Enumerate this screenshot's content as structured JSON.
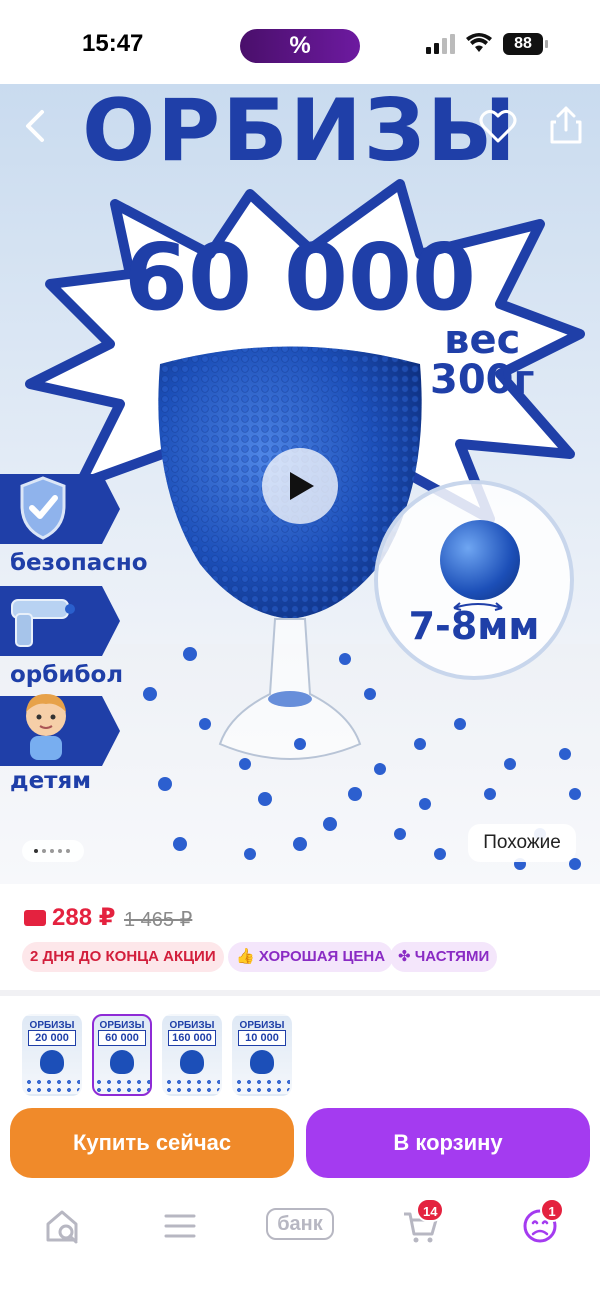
{
  "status_bar": {
    "time": "15:47",
    "promo_pill": "%",
    "battery": "88"
  },
  "hero": {
    "title": "ОРБИЗЫ",
    "count": "60 000",
    "weight_line1": "вес",
    "weight_line2": "300г",
    "size": "7-8мм",
    "features": [
      "безопасно",
      "орбибол",
      "детям"
    ],
    "similar_label": "Похожие",
    "pager": {
      "total": 5,
      "current": 1
    }
  },
  "price": {
    "current": "288 ₽",
    "old": "1 465 ₽",
    "badges": {
      "promo": "2 ДНЯ ДО КОНЦА АКЦИИ",
      "good_price": "ХОРОШАЯ ЦЕНА",
      "installments": "ЧАСТЯМИ"
    }
  },
  "variants": [
    {
      "title": "ОРБИЗЫ",
      "count": "20 000",
      "selected": false
    },
    {
      "title": "ОРБИЗЫ",
      "count": "60 000",
      "selected": true
    },
    {
      "title": "ОРБИЗЫ",
      "count": "160 000",
      "selected": false
    },
    {
      "title": "ОРБИЗЫ",
      "count": "10 000",
      "selected": false
    }
  ],
  "actions": {
    "buy_now": "Купить сейчас",
    "add_to_cart": "В корзину"
  },
  "tabbar": {
    "bank_label": "банк",
    "cart_count": "14",
    "profile_count": "1"
  },
  "colors": {
    "brand_blue": "#1f3fa8",
    "price_red": "#e4223f",
    "buy_orange": "#f08a2a",
    "cart_purple": "#a43bf0"
  }
}
